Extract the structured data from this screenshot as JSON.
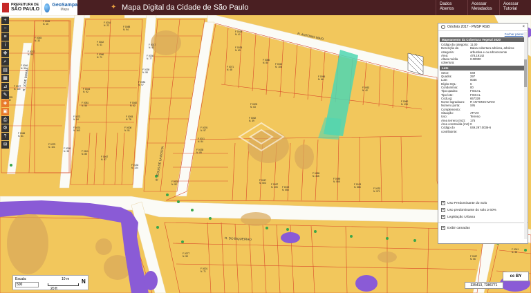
{
  "header": {
    "prefeitura_line1": "PREFEITURA DE",
    "prefeitura_line2": "SÃO PAULO",
    "geosampa": "GeoSampa",
    "geosampa_sub": "Mapa",
    "title": "Mapa Digital da Cidade de São Paulo",
    "buttons": [
      {
        "label": "Dados Abertos"
      },
      {
        "label": "Acessar Metadados"
      },
      {
        "label": "Acessar Tutorial"
      }
    ]
  },
  "toolbar": {
    "icons": [
      "plus-icon",
      "minus-icon",
      "layers-icon",
      "info-icon",
      "pan-icon",
      "zoom-box-icon",
      "bookmark-icon",
      "print-icon",
      "gear-icon",
      "search-icon",
      "ruler-icon",
      "draw-icon",
      "share-icon",
      "printer-icon",
      "settings-icon",
      "help-icon",
      "mail-icon"
    ]
  },
  "map": {
    "streets": [
      "R. ANTONIO MAIO",
      "R. DO BIQUEIRAO",
      "R. JOSE BORBA",
      "R. JESUS DE LA ROSTA"
    ],
    "lot_labels": [
      {
        "id": "F 0026",
        "n": "N. 15"
      },
      {
        "id": "F 0028",
        "n": "N. 41"
      },
      {
        "id": "F 0034",
        "n": "N. 22"
      },
      {
        "id": "F 0088",
        "n": "N. 94"
      },
      {
        "id": "F 0045",
        "n": "N. 33"
      },
      {
        "id": "F 0035",
        "n": "N. 69"
      },
      {
        "id": "F 0042",
        "n": "N. 41"
      },
      {
        "id": "F 0017",
        "n": "N. 42"
      },
      {
        "id": "F 0037",
        "n": "N. 98"
      },
      {
        "id": "F 0086",
        "n": "N. 71"
      },
      {
        "id": "F 0036",
        "n": "N. 77"
      },
      {
        "id": "F 0080",
        "n": "N. 84"
      },
      {
        "id": "F 0071",
        "n": "N. 48"
      },
      {
        "id": "F 0022",
        "n": "N. 106"
      },
      {
        "id": "F 0027",
        "n": "N. 115"
      },
      {
        "id": "F 0025",
        "n": "N. 82"
      },
      {
        "id": "F 0046",
        "n": "N. 90"
      },
      {
        "id": "F 0044",
        "n": "N. 92"
      },
      {
        "id": "F 0039",
        "n": "N. 58"
      },
      {
        "id": "F 0084",
        "n": "N. 97"
      },
      {
        "id": "F 0081",
        "n": "N. 56"
      },
      {
        "id": "F 0082",
        "n": "N. 42"
      },
      {
        "id": "F 0056",
        "n": "N. 66"
      },
      {
        "id": "F 0062",
        "n": "N. 42"
      },
      {
        "id": "F 0003",
        "n": "N. 63"
      },
      {
        "id": "F 0073",
        "n": "N. 54"
      },
      {
        "id": "F 0093",
        "n": "N. 78"
      },
      {
        "id": "F 0060",
        "n": "N. 134"
      },
      {
        "id": "F 0052",
        "n": "N. 39"
      },
      {
        "id": "F 0074",
        "n": "N. 163"
      },
      {
        "id": "F 0008",
        "n": "N. 51"
      },
      {
        "id": "F 0076",
        "n": "N. 97"
      },
      {
        "id": "F 0066",
        "n": "N. 81"
      },
      {
        "id": "F 0075",
        "n": "N. 101"
      },
      {
        "id": "F 0111",
        "n": "N. 85"
      },
      {
        "id": "F 0011",
        "n": "N. 84"
      },
      {
        "id": "F 0009",
        "n": "N. 35"
      },
      {
        "id": "F 0035",
        "n": "N. 89"
      },
      {
        "id": "F 0067",
        "n": "N. 97"
      },
      {
        "id": "F 0133",
        "n": "N. 134"
      },
      {
        "id": "F 0085",
        "n": "N. 345"
      },
      {
        "id": "F 0089",
        "n": "N. 555"
      },
      {
        "id": "F 0047",
        "n": "N. 503"
      },
      {
        "id": "F 0057",
        "n": "N. 405"
      },
      {
        "id": "F 0019",
        "n": "N. 555"
      },
      {
        "id": "F 0013",
        "n": "N. 565"
      },
      {
        "id": "F 0032",
        "n": "N. 571"
      },
      {
        "id": "F 0002",
        "n": "N. 52"
      },
      {
        "id": "F 0077",
        "n": "N. 59"
      },
      {
        "id": "F 0001",
        "n": "N. 71"
      },
      {
        "id": "F 0067",
        "n": "N. 56"
      },
      {
        "id": "F 0041",
        "n": "N. 38"
      }
    ]
  },
  "panel": {
    "layer_title": "Ortofoto 2017 - PMSP RGB",
    "close_link": "Fechar painel",
    "section1": "Mapeamento da Cobertura Vegetal 2020",
    "vegetation": [
      {
        "k": "Código da categoria:",
        "v": "11.00"
      },
      {
        "k": "Descrição da categoria:",
        "v": "Baixa cobertura arbórea, arbóreo-arbustiva e ou arborescente"
      },
      {
        "k": "Área:",
        "v": "478,19142"
      },
      {
        "k": "Altura média cobertura:",
        "v": "0.00000"
      }
    ],
    "section2": "Lote",
    "lote": [
      {
        "k": "Setor:",
        "v": "049"
      },
      {
        "k": "Quadra:",
        "v": "297"
      },
      {
        "k": "Lote:",
        "v": "0036"
      },
      {
        "k": "Dígito SQL:",
        "v": "6"
      },
      {
        "k": "Condomínio:",
        "v": "00"
      },
      {
        "k": "Tipo quadra:",
        "v": "FISCAL"
      },
      {
        "k": "Tipo lote:",
        "v": "FISCAL"
      },
      {
        "k": "CodLog:",
        "v": "657328"
      },
      {
        "k": "Nome logradouro:",
        "v": "R ANTONIO MAIO"
      },
      {
        "k": "Número porta:",
        "v": "S/N"
      },
      {
        "k": "Complemento:",
        "v": ""
      },
      {
        "k": "Situação:",
        "v": "ATIVO"
      },
      {
        "k": "Uso:",
        "v": "Terreno"
      },
      {
        "k": "Área terreno (m2):",
        "v": "175"
      },
      {
        "k": "Área construída (m2):",
        "v": "0"
      },
      {
        "k": "Código do contribuinte:",
        "v": "049.297.0036-6"
      }
    ],
    "layers": [
      {
        "label": "Uso Predominante do Solo"
      },
      {
        "label": "Uso predominante do solo ≥ 60%"
      },
      {
        "label": "Legislação Urbana"
      },
      {
        "label": "Exibir camadas"
      }
    ]
  },
  "scale": {
    "label": "Escala:",
    "value": "500",
    "m": "10 m",
    "ft": "20 ft",
    "north": "N"
  },
  "coords": "335413, 7386771",
  "cc": "cc BY",
  "colors": {
    "header": "#4a1f22",
    "lot_fill": "#f2c75c",
    "street": "#ffffff",
    "lot_line": "#d94a2a",
    "purple": "#8a5bd6",
    "highlight": "#4fd6b2"
  }
}
